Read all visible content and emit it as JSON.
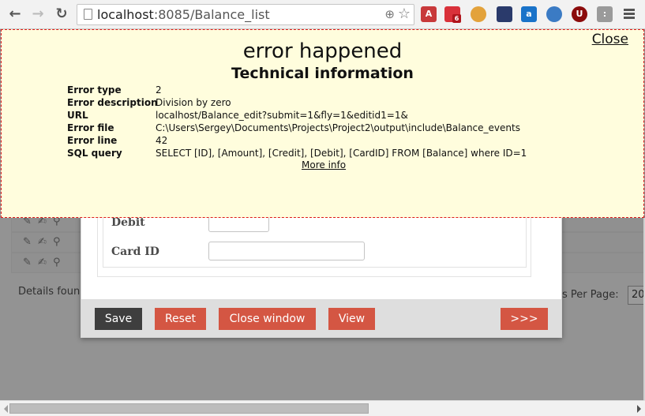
{
  "browser": {
    "url_host": "localhost",
    "url_rest": ":8085/Balance_list",
    "extensions": [
      {
        "name": "book-extension-icon",
        "color": "#c8393a",
        "glyph": "A"
      },
      {
        "name": "bird-extension-icon",
        "color": "#d9313a",
        "glyph": "",
        "badge": "6"
      },
      {
        "name": "cookie-extension-icon",
        "color": "#e3a23b",
        "glyph": ""
      },
      {
        "name": "speedometer-extension-icon",
        "color": "#2a3a6b",
        "glyph": ""
      },
      {
        "name": "amazon-extension-icon",
        "color": "#1a73c9",
        "glyph": "a"
      },
      {
        "name": "globe-extension-icon",
        "color": "#3b7bc4",
        "glyph": ""
      },
      {
        "name": "ublock-extension-icon",
        "color": "#8b0b0b",
        "glyph": "U"
      },
      {
        "name": "plug-extension-icon",
        "color": "#9a9a9a",
        "glyph": ":"
      }
    ]
  },
  "error_panel": {
    "close_label": "Close",
    "title": "error happened",
    "subtitle": "Technical information",
    "rows": [
      {
        "key": "Error type",
        "value": "2"
      },
      {
        "key": "Error description",
        "value": "Division by zero"
      },
      {
        "key": "URL",
        "value": "localhost/Balance_edit?submit=1&fly=1&editid1=1&"
      },
      {
        "key": "Error file",
        "value": "C:\\Users\\Sergey\\Documents\\Projects\\Project2\\output\\include\\Balance_events"
      },
      {
        "key": "Error line",
        "value": "42"
      },
      {
        "key": "SQL query",
        "value": "SELECT [ID], [Amount], [Credit], [Debit], [CardID] FROM [Balance] where ID=1"
      }
    ],
    "more_info_label": "More info"
  },
  "modal": {
    "fields": [
      {
        "label": "Debit",
        "value": ""
      },
      {
        "label": "Card ID",
        "value": ""
      }
    ],
    "buttons": {
      "save": "Save",
      "reset": "Reset",
      "close_window": "Close window",
      "view": "View",
      "next": ">>>"
    }
  },
  "background_page": {
    "row_icons": "✎ ✍ ⚲",
    "details_found": "Details foun",
    "per_page_label": "s Per Page:",
    "per_page_value": "20"
  }
}
